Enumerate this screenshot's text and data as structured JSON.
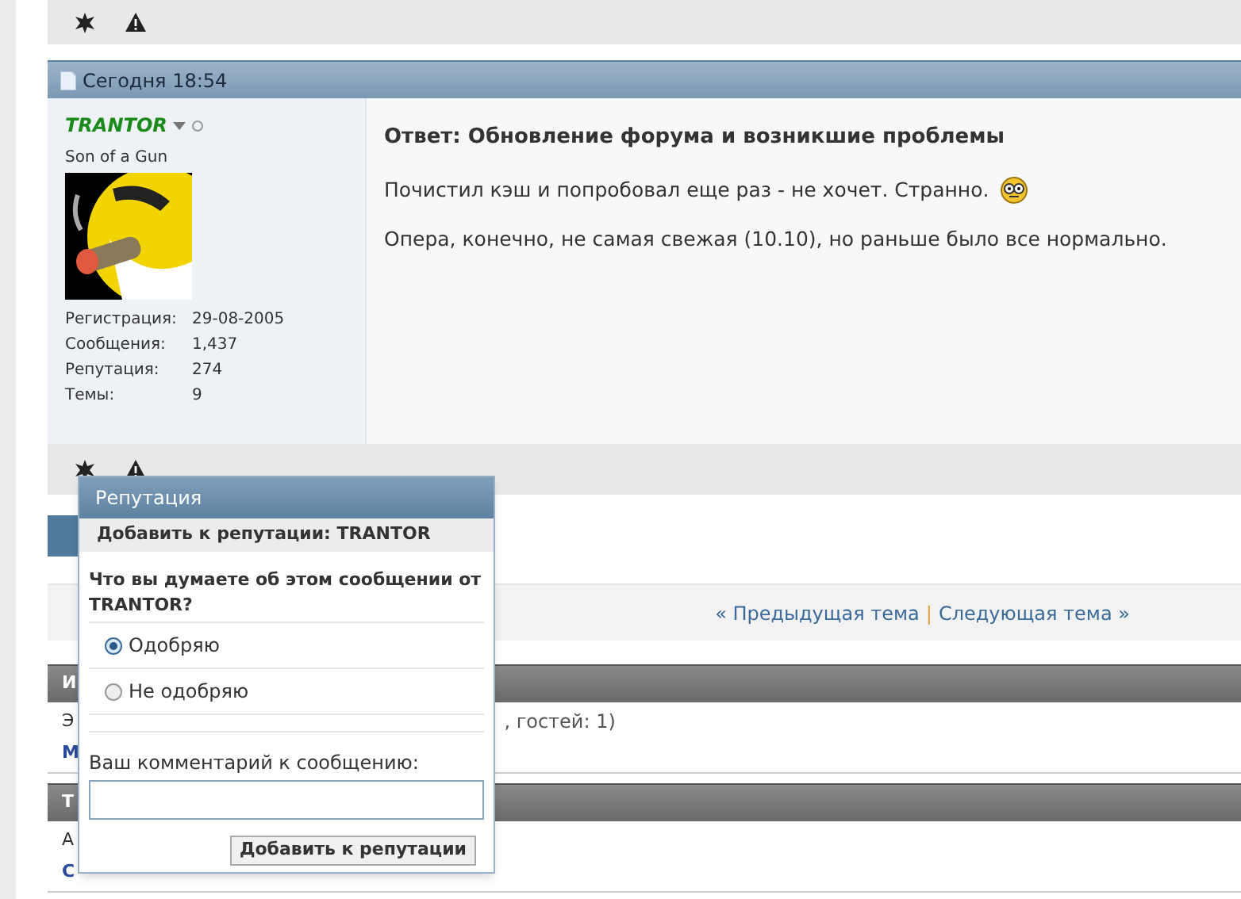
{
  "post": {
    "date": "Сегодня 18:54",
    "user": {
      "name": "TRANTOR",
      "online": false,
      "title": "Son of a Gun",
      "stats": [
        {
          "label": "Регистрация:",
          "value": "29-08-2005"
        },
        {
          "label": "Сообщения:",
          "value": "1,437"
        },
        {
          "label": "Репутация:",
          "value": "274"
        },
        {
          "label": "Темы:",
          "value": "9"
        }
      ]
    },
    "title": "Ответ: Обновление форума и возникшие проблемы",
    "paragraphs": [
      {
        "text": "Почистил кэш и попробовал еще раз - не хочет. Странно.",
        "smiley": true
      },
      {
        "text": "Опера, конечно, не самая свежая (10.10), но раньше было все нормально.",
        "smiley": false
      }
    ]
  },
  "thread_nav": {
    "prev": "« Предыдущая тема",
    "separator": "|",
    "next": "Следующая тема »"
  },
  "sections": [
    {
      "heading": "И",
      "lines": [
        {
          "text": "Э",
          "tail": ", гостей: 1)",
          "link": false
        },
        {
          "text": "М",
          "link": true
        }
      ]
    },
    {
      "heading": "Т",
      "lines": [
        {
          "text": "А",
          "link": false
        },
        {
          "text": "С",
          "link": true
        }
      ]
    }
  ],
  "popup": {
    "title": "Репутация",
    "subtitle": "Добавить к репутации: TRANTOR",
    "question": "Что вы думаете об этом сообщении от TRANTOR?",
    "options": [
      {
        "label": "Одобряю",
        "selected": true
      },
      {
        "label": "Не одобряю",
        "selected": false
      }
    ],
    "comment_label": "Ваш комментарий к сообщению:",
    "button": "Добавить к репутации"
  }
}
